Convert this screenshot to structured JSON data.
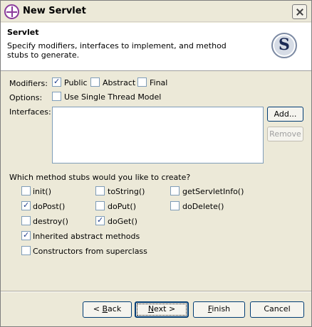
{
  "window": {
    "title": "New Servlet"
  },
  "header": {
    "title": "Servlet",
    "description": "Specify modifiers, interfaces to implement, and method stubs to generate.",
    "icon_letter": "S"
  },
  "modifiers": {
    "label": "Modifiers:",
    "items": [
      {
        "label": "Public",
        "checked": true
      },
      {
        "label": "Abstract",
        "checked": false
      },
      {
        "label": "Final",
        "checked": false
      }
    ]
  },
  "options": {
    "label": "Options:",
    "single_thread_label": "Use Single Thread Model",
    "single_thread_checked": false
  },
  "interfaces": {
    "label": "Interfaces:",
    "add_button": "Add...",
    "remove_button": "Remove"
  },
  "method_stubs": {
    "question": "Which method stubs would you like to create?",
    "items": [
      {
        "label": "init()",
        "checked": false
      },
      {
        "label": "toString()",
        "checked": false
      },
      {
        "label": "getServletInfo()",
        "checked": false
      },
      {
        "label": "doPost()",
        "checked": true
      },
      {
        "label": "doPut()",
        "checked": false
      },
      {
        "label": "doDelete()",
        "checked": false
      },
      {
        "label": "destroy()",
        "checked": false
      },
      {
        "label": "doGet()",
        "checked": true
      }
    ],
    "inherited_label": "Inherited abstract methods",
    "inherited_checked": true,
    "constructors_label": "Constructors from superclass",
    "constructors_checked": false
  },
  "footer": {
    "back_button": "< Back",
    "next_button": "Next >",
    "finish_button": "Finish",
    "cancel_button": "Cancel"
  }
}
